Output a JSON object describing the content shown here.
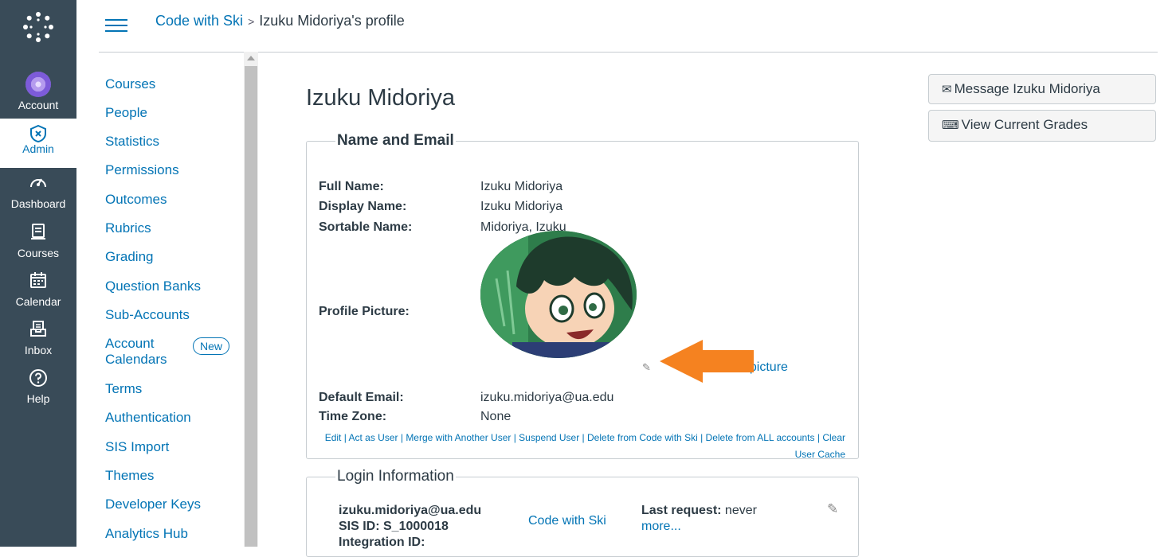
{
  "global_nav": {
    "items": [
      {
        "label": "Account",
        "icon": "account-avatar"
      },
      {
        "label": "Admin",
        "icon": "admin-shield-icon"
      },
      {
        "label": "Dashboard",
        "icon": "dashboard-icon"
      },
      {
        "label": "Courses",
        "icon": "courses-icon"
      },
      {
        "label": "Calendar",
        "icon": "calendar-icon"
      },
      {
        "label": "Inbox",
        "icon": "inbox-icon"
      },
      {
        "label": "Help",
        "icon": "help-icon"
      }
    ],
    "active": "Admin"
  },
  "breadcrumb": {
    "root": "Code with Ski",
    "separator": ">",
    "current": "Izuku Midoriya's profile"
  },
  "section_nav": {
    "items": [
      "Courses",
      "People",
      "Statistics",
      "Permissions",
      "Outcomes",
      "Rubrics",
      "Grading",
      "Question Banks",
      "Sub-Accounts",
      "Account Calendars",
      "Terms",
      "Authentication",
      "SIS Import",
      "Themes",
      "Developer Keys",
      "Analytics Hub"
    ],
    "new_badge": "New"
  },
  "profile": {
    "name": "Izuku Midoriya",
    "name_email": {
      "legend": "Name and Email",
      "full_name_label": "Full Name:",
      "full_name": "Izuku Midoriya",
      "display_name_label": "Display Name:",
      "display_name": "Izuku Midoriya",
      "sortable_name_label": "Sortable Name:",
      "sortable_name": "Midoriya, Izuku",
      "profile_picture_label": "Profile Picture:",
      "change_picture_partial": "picture",
      "default_email_label": "Default Email:",
      "default_email": "izuku.midoriya@ua.edu",
      "time_zone_label": "Time Zone:",
      "time_zone": "None"
    },
    "actions": [
      "Edit",
      "Act as User",
      "Merge with Another User",
      "Suspend User",
      "Delete from Code with Ski",
      "Delete from ALL accounts",
      "Clear User Cache"
    ],
    "login": {
      "legend": "Login Information",
      "login_id": "izuku.midoriya@ua.edu",
      "sis_id": "SIS ID: S_1000018",
      "integration_id": "Integration ID:",
      "account": "Code with Ski",
      "last_request_label": "Last request:",
      "last_request_value": "never",
      "more": "more..."
    }
  },
  "buttons": {
    "message": "Message Izuku Midoriya",
    "grades": "View Current Grades"
  },
  "colors": {
    "nav_bg": "#394b58",
    "link": "#0374b5",
    "annotation_arrow": "#f58220"
  }
}
